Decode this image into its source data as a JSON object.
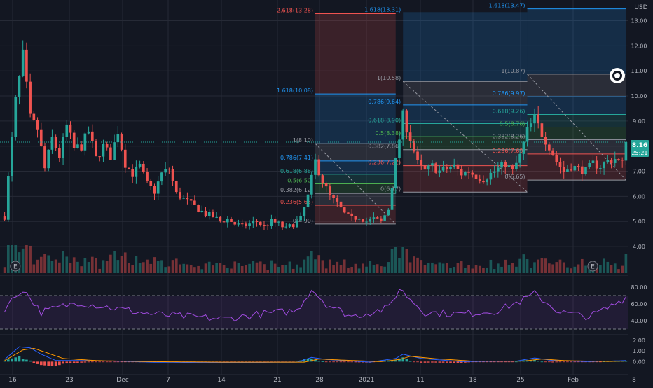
{
  "currency": "USD",
  "colors": {
    "bg": "#131722",
    "grid": "#262a36",
    "up": "#26a69a",
    "down": "#ef5350",
    "text": "#b2b5be",
    "rsi": "#a14ce0",
    "macd": "#2962ff",
    "signal": "#ff9800",
    "fib_red": "#ef5350",
    "fib_blue": "#2196f3",
    "fib_green": "#4caf50",
    "fib_grey": "#9598a1",
    "price_badge": "#26a69a"
  },
  "price": {
    "last": "8.16",
    "timer": "25:21",
    "last_value": 8.16
  },
  "earnings_marker": "E",
  "chart_data": [
    {
      "type": "candlestick",
      "x_ticks": [
        "16",
        "23",
        "Dec",
        "7",
        "14",
        "21",
        "28",
        "2021",
        "11",
        "18",
        "25",
        "Feb",
        "8"
      ],
      "y_ticks": [
        "4.00",
        "5.00",
        "6.00",
        "7.00",
        "8.00",
        "9.00",
        "10.00",
        "11.00",
        "12.00",
        "13.00"
      ],
      "ylim": [
        3.5,
        13.6
      ],
      "anchors": [
        [
          0,
          5.2
        ],
        [
          3,
          9.8
        ],
        [
          5,
          11.6
        ],
        [
          7,
          9.1
        ],
        [
          9,
          8.7
        ],
        [
          11,
          7.1
        ],
        [
          13,
          8.3
        ],
        [
          15,
          7.6
        ],
        [
          17,
          8.8
        ],
        [
          19,
          7.9
        ],
        [
          21,
          8.0
        ],
        [
          23,
          8.6
        ],
        [
          25,
          7.5
        ],
        [
          27,
          8.0
        ],
        [
          29,
          7.6
        ],
        [
          31,
          8.6
        ],
        [
          33,
          7.3
        ],
        [
          35,
          6.9
        ],
        [
          37,
          7.2
        ],
        [
          39,
          6.5
        ],
        [
          41,
          6.2
        ],
        [
          43,
          6.9
        ],
        [
          45,
          7.1
        ],
        [
          47,
          6.1
        ],
        [
          49,
          5.9
        ],
        [
          51,
          5.7
        ],
        [
          53,
          5.5
        ],
        [
          55,
          5.3
        ],
        [
          57,
          5.2
        ],
        [
          59,
          5.0
        ],
        [
          61,
          5.1
        ],
        [
          63,
          4.9
        ],
        [
          65,
          4.8
        ],
        [
          67,
          4.9
        ],
        [
          69,
          5.0
        ],
        [
          71,
          4.8
        ],
        [
          73,
          5.0
        ],
        [
          75,
          4.9
        ],
        [
          77,
          4.7
        ],
        [
          79,
          4.9
        ],
        [
          81,
          5.1
        ],
        [
          83,
          6.0
        ],
        [
          85,
          7.4
        ],
        [
          87,
          6.6
        ],
        [
          89,
          6.0
        ],
        [
          91,
          5.7
        ],
        [
          93,
          5.3
        ],
        [
          95,
          5.1
        ],
        [
          97,
          5.2
        ],
        [
          99,
          5.0
        ],
        [
          101,
          5.1
        ],
        [
          103,
          5.0
        ],
        [
          105,
          5.5
        ],
        [
          107,
          7.4
        ],
        [
          109,
          9.2
        ],
        [
          111,
          8.3
        ],
        [
          113,
          7.3
        ],
        [
          115,
          7.0
        ],
        [
          117,
          7.2
        ],
        [
          119,
          7.0
        ],
        [
          121,
          7.1
        ],
        [
          123,
          7.2
        ],
        [
          125,
          6.9
        ],
        [
          127,
          7.0
        ],
        [
          129,
          6.8
        ],
        [
          131,
          6.7
        ],
        [
          133,
          6.9
        ],
        [
          135,
          7.1
        ],
        [
          137,
          7.3
        ],
        [
          139,
          7.0
        ],
        [
          141,
          7.6
        ],
        [
          143,
          8.6
        ],
        [
          145,
          9.1
        ],
        [
          147,
          8.5
        ],
        [
          149,
          8.0
        ],
        [
          151,
          7.4
        ],
        [
          153,
          7.0
        ],
        [
          155,
          7.2
        ],
        [
          157,
          7.1
        ],
        [
          159,
          7.0
        ],
        [
          161,
          7.3
        ],
        [
          163,
          7.2
        ],
        [
          165,
          7.4
        ],
        [
          167,
          7.5
        ],
        [
          169,
          7.3
        ],
        [
          170,
          8.16
        ]
      ],
      "earnings_at": [
        1,
        159
      ]
    },
    {
      "type": "fibonacci",
      "retracements": [
        {
          "x_start": 85,
          "x_end": 107,
          "levels": [
            {
              "label": "0(4.90)",
              "value": 4.9,
              "color": "#9598a1"
            },
            {
              "label": "0.236(5.65)",
              "value": 5.65,
              "color": "#ef5350"
            },
            {
              "label": "0.382(6.12)",
              "value": 6.12,
              "color": "#9598a1"
            },
            {
              "label": "0.5(6.50)",
              "value": 6.5,
              "color": "#4caf50"
            },
            {
              "label": "0.618(6.88)",
              "value": 6.88,
              "color": "#26a69a"
            },
            {
              "label": "0.786(7.41)",
              "value": 7.41,
              "color": "#2196f3"
            },
            {
              "label": "1(8.10)",
              "value": 8.1,
              "color": "#9598a1"
            },
            {
              "label": "1.618(10.08)",
              "value": 10.08,
              "color": "#2196f3"
            },
            {
              "label": "2.618(13.28)",
              "value": 13.28,
              "color": "#ef5350"
            }
          ]
        },
        {
          "x_start": 109,
          "x_end": 143,
          "levels": [
            {
              "label": "0(6.17)",
              "value": 6.17,
              "color": "#9598a1"
            },
            {
              "label": "0.236(7.22)",
              "value": 7.22,
              "color": "#ef5350"
            },
            {
              "label": "0.382(7.86)",
              "value": 7.86,
              "color": "#9598a1"
            },
            {
              "label": "0.5(8.38)",
              "value": 8.38,
              "color": "#4caf50"
            },
            {
              "label": "0.618(8.90)",
              "value": 8.9,
              "color": "#26a69a"
            },
            {
              "label": "0.786(9.64)",
              "value": 9.64,
              "color": "#2196f3"
            },
            {
              "label": "1(10.58)",
              "value": 10.58,
              "color": "#9598a1"
            },
            {
              "label": "1.618(13.31)",
              "value": 13.31,
              "color": "#2196f3"
            }
          ]
        },
        {
          "x_start": 143,
          "x_end": 170,
          "levels": [
            {
              "label": "0(6.65)",
              "value": 6.65,
              "color": "#9598a1"
            },
            {
              "label": "0.236(7.69)",
              "value": 7.69,
              "color": "#ef5350"
            },
            {
              "label": "0.382(8.26)",
              "value": 8.26,
              "color": "#9598a1"
            },
            {
              "label": "0.5(8.76)",
              "value": 8.76,
              "color": "#4caf50"
            },
            {
              "label": "0.618(9.26)",
              "value": 9.26,
              "color": "#26a69a"
            },
            {
              "label": "0.786(9.97)",
              "value": 9.97,
              "color": "#2196f3"
            },
            {
              "label": "1(10.87)",
              "value": 10.87,
              "color": "#9598a1"
            },
            {
              "label": "1.618(13.47)",
              "value": 13.47,
              "color": "#2196f3"
            }
          ]
        }
      ]
    },
    {
      "type": "line",
      "name": "",
      "y_ticks": [
        "80.00",
        "60.00",
        "40.00"
      ],
      "ylim": [
        25,
        90
      ],
      "bands": [
        70,
        30
      ],
      "anchors": [
        [
          0,
          55
        ],
        [
          5,
          78
        ],
        [
          10,
          50
        ],
        [
          20,
          62
        ],
        [
          30,
          55
        ],
        [
          40,
          48
        ],
        [
          50,
          45
        ],
        [
          60,
          42
        ],
        [
          70,
          48
        ],
        [
          80,
          52
        ],
        [
          84,
          78
        ],
        [
          88,
          60
        ],
        [
          95,
          45
        ],
        [
          105,
          55
        ],
        [
          108,
          78
        ],
        [
          115,
          50
        ],
        [
          125,
          48
        ],
        [
          135,
          52
        ],
        [
          142,
          65
        ],
        [
          145,
          72
        ],
        [
          152,
          50
        ],
        [
          160,
          45
        ],
        [
          165,
          55
        ],
        [
          170,
          68
        ]
      ]
    },
    {
      "type": "line",
      "name": "",
      "y_ticks": [
        "2.00",
        "1.00",
        "0.00"
      ],
      "ylim": [
        -0.9,
        2.4
      ],
      "macd": [
        [
          0,
          0.2
        ],
        [
          4,
          1.4
        ],
        [
          7,
          1.3
        ],
        [
          10,
          0.7
        ],
        [
          14,
          0.1
        ],
        [
          20,
          0.1
        ],
        [
          30,
          0.05
        ],
        [
          40,
          -0.05
        ],
        [
          60,
          -0.1
        ],
        [
          80,
          -0.05
        ],
        [
          84,
          0.4
        ],
        [
          88,
          0.2
        ],
        [
          100,
          -0.05
        ],
        [
          107,
          0.3
        ],
        [
          109,
          0.7
        ],
        [
          114,
          0.3
        ],
        [
          125,
          0.0
        ],
        [
          140,
          0.05
        ],
        [
          145,
          0.35
        ],
        [
          150,
          0.1
        ],
        [
          160,
          0.0
        ],
        [
          170,
          0.1
        ]
      ],
      "signal": [
        [
          0,
          0.1
        ],
        [
          5,
          1.1
        ],
        [
          8,
          1.25
        ],
        [
          11,
          0.9
        ],
        [
          16,
          0.3
        ],
        [
          25,
          0.1
        ],
        [
          40,
          0.0
        ],
        [
          60,
          -0.05
        ],
        [
          82,
          -0.05
        ],
        [
          86,
          0.25
        ],
        [
          92,
          0.15
        ],
        [
          103,
          0.0
        ],
        [
          108,
          0.2
        ],
        [
          111,
          0.5
        ],
        [
          117,
          0.3
        ],
        [
          128,
          0.05
        ],
        [
          142,
          0.05
        ],
        [
          147,
          0.25
        ],
        [
          153,
          0.1
        ],
        [
          165,
          0.02
        ],
        [
          170,
          0.05
        ]
      ]
    }
  ]
}
